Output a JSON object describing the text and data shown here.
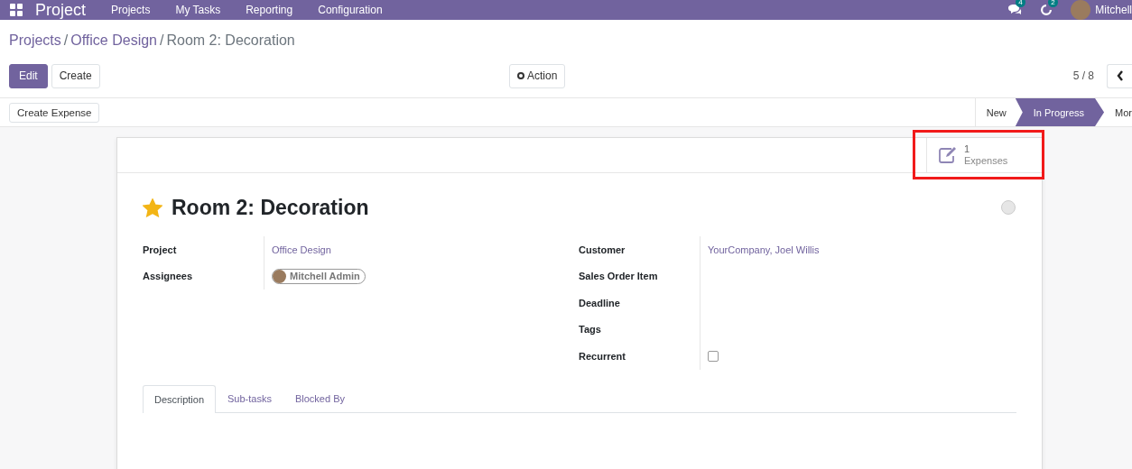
{
  "navbar": {
    "app_title": "Project",
    "menu": [
      "Projects",
      "My Tasks",
      "Reporting",
      "Configuration"
    ],
    "messages_count": "4",
    "activities_count": "2",
    "user": "Mitchell"
  },
  "breadcrumb": [
    {
      "label": "Projects",
      "link": true
    },
    {
      "separator": "/",
      "label": "Office Design",
      "link": true
    },
    {
      "separator": "/",
      "label": "Room 2: Decoration",
      "link": false
    }
  ],
  "control_buttons": [
    {
      "label": "Edit",
      "primary": true
    },
    {
      "label": "Create",
      "primary": false
    }
  ],
  "action_button": "Action",
  "pager": "5 / 8",
  "header_buttons": [
    "Create Expense"
  ],
  "stages": [
    {
      "label": "New",
      "selected": false
    },
    {
      "label": "In Progress",
      "selected": true
    },
    {
      "label": "Mor",
      "selected": false
    }
  ],
  "smart_button": {
    "count": "1",
    "label": "Expenses",
    "highlighted": true
  },
  "record": {
    "starred": true,
    "title": "Room 2: Decoration"
  },
  "left_fields": [
    {
      "label": "Project",
      "kind": "link",
      "value": "Office Design"
    },
    {
      "label": "Assignees",
      "kind": "tag",
      "value": "Mitchell Admin"
    }
  ],
  "right_fields": [
    {
      "label": "Customer",
      "kind": "link",
      "value": "YourCompany, Joel Willis"
    },
    {
      "label": "Sales Order Item",
      "kind": "empty"
    },
    {
      "label": "Deadline",
      "kind": "empty"
    },
    {
      "label": "Tags",
      "kind": "empty"
    },
    {
      "label": "Recurrent",
      "kind": "checkbox",
      "checked": false
    }
  ],
  "tabs": [
    {
      "label": "Description",
      "selected": true
    },
    {
      "label": "Sub-tasks",
      "selected": false
    },
    {
      "label": "Blocked By",
      "selected": false
    }
  ]
}
